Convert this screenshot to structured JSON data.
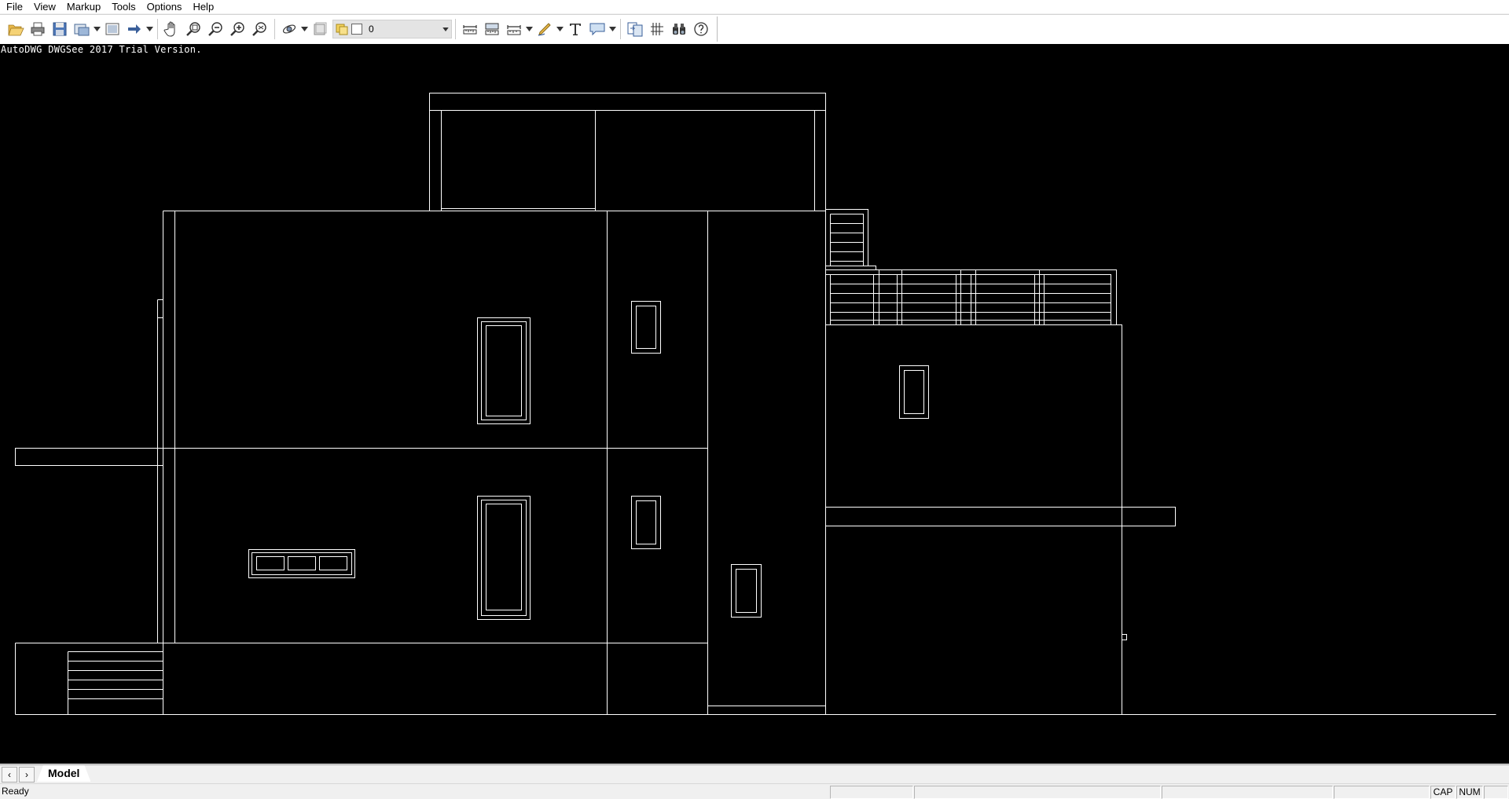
{
  "menu": {
    "items": [
      "File",
      "View",
      "Markup",
      "Tools",
      "Options",
      "Help"
    ]
  },
  "toolbar": {
    "layer_value": "0",
    "icons": [
      "open-folder-icon",
      "print-icon",
      "save-icon",
      "export-icon",
      "view-icon",
      "arrow-icon",
      "pan-hand-icon",
      "zoom-window-icon",
      "zoom-out-icon",
      "zoom-in-icon",
      "zoom-extents-icon",
      "orbit-icon",
      "layer-frame-icon",
      "layer-manager-icon",
      "measure-distance-icon",
      "measure-area-icon",
      "dimension-icon",
      "sketch-pen-icon",
      "text-icon",
      "callout-icon",
      "compare-icon",
      "hatch-lines-icon",
      "binoculars-icon",
      "help-icon"
    ]
  },
  "drawing": {
    "watermark": "AutoDWG DWGSee 2017 Trial Version.",
    "background_color": "#000000",
    "line_color": "#ffffff"
  },
  "tabs": {
    "model_label": "Model",
    "prev_label": "‹",
    "next_label": "›"
  },
  "status": {
    "text": "Ready",
    "cap": "CAP",
    "num": "NUM"
  }
}
